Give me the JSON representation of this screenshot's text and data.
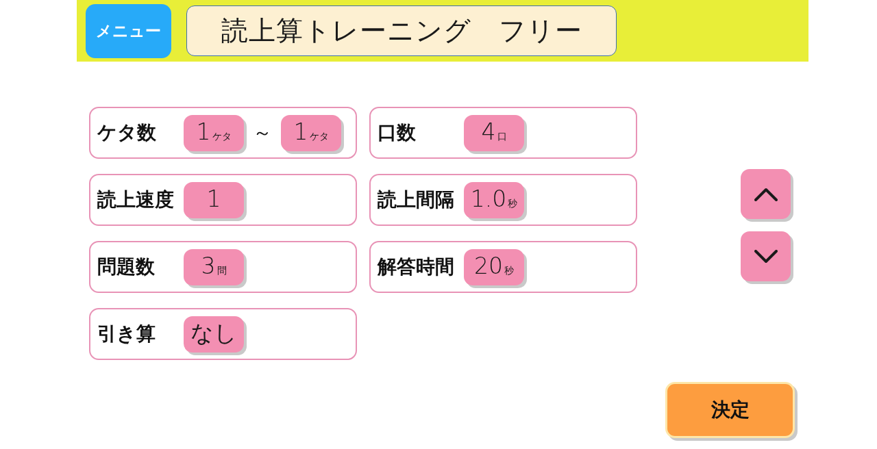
{
  "header": {
    "menu_button": "メニュー",
    "title": "読上算トレーニング　フリー"
  },
  "settings": [
    {
      "label": "ケタ数",
      "kind": "range",
      "values": [
        {
          "number": "1",
          "unit": "ケタ"
        },
        {
          "number": "1",
          "unit": "ケタ"
        }
      ],
      "separator": "～"
    },
    {
      "label": "口数",
      "kind": "single",
      "values": [
        {
          "number": "4",
          "unit": "口"
        }
      ]
    },
    {
      "label": "読上速度",
      "kind": "single",
      "values": [
        {
          "number": "1"
        }
      ]
    },
    {
      "label": "読上間隔",
      "kind": "single",
      "values": [
        {
          "number": "1.0",
          "unit": "秒"
        }
      ]
    },
    {
      "label": "問題数",
      "kind": "single",
      "values": [
        {
          "number": "3",
          "unit": "問"
        }
      ]
    },
    {
      "label": "解答時間",
      "kind": "single",
      "values": [
        {
          "number": "20",
          "unit": "秒"
        }
      ]
    },
    {
      "label": "引き算",
      "kind": "single",
      "values": [
        {
          "number": "なし"
        }
      ]
    }
  ],
  "confirm_button": "決定"
}
